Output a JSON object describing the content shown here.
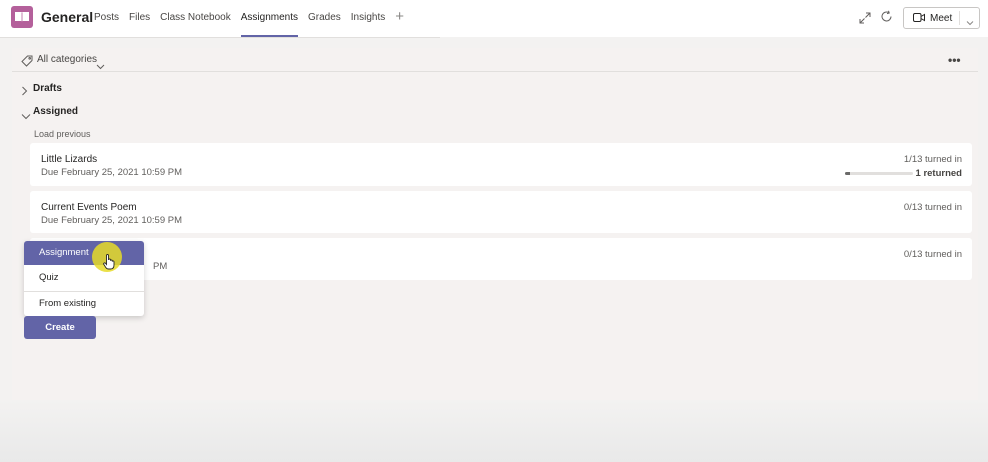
{
  "header": {
    "team_name": "General",
    "tabs": [
      {
        "label": "Posts",
        "active": false
      },
      {
        "label": "Files",
        "active": false
      },
      {
        "label": "Class Notebook",
        "active": false
      },
      {
        "label": "Assignments",
        "active": true
      },
      {
        "label": "Grades",
        "active": false
      },
      {
        "label": "Insights",
        "active": false
      }
    ],
    "add_tab_icon": "plus-icon",
    "meet_label": "Meet"
  },
  "filter": {
    "label": "All categories",
    "more_label": "•••"
  },
  "sections": {
    "drafts": "Drafts",
    "assigned": "Assigned",
    "load_previous": "Load previous"
  },
  "assignments": [
    {
      "title": "Little Lizards",
      "due": "Due February 25, 2021 10:59 PM",
      "turned_in": "1/13 turned in",
      "returned": "1 returned",
      "progress": 0.077
    },
    {
      "title": "Current Events Poem",
      "due": "Due February 25, 2021 10:59 PM",
      "turned_in": "0/13 turned in"
    },
    {
      "title": "",
      "due_visible": "PM",
      "turned_in": "0/13 turned in"
    }
  ],
  "create_menu": {
    "items": [
      "Assignment",
      "Quiz",
      "From existing"
    ],
    "selected": "Assignment"
  },
  "create_button": "Create",
  "colors": {
    "accent": "#6264a7",
    "team_icon": "#b4609b",
    "cursor_highlight": "#e6da28"
  }
}
